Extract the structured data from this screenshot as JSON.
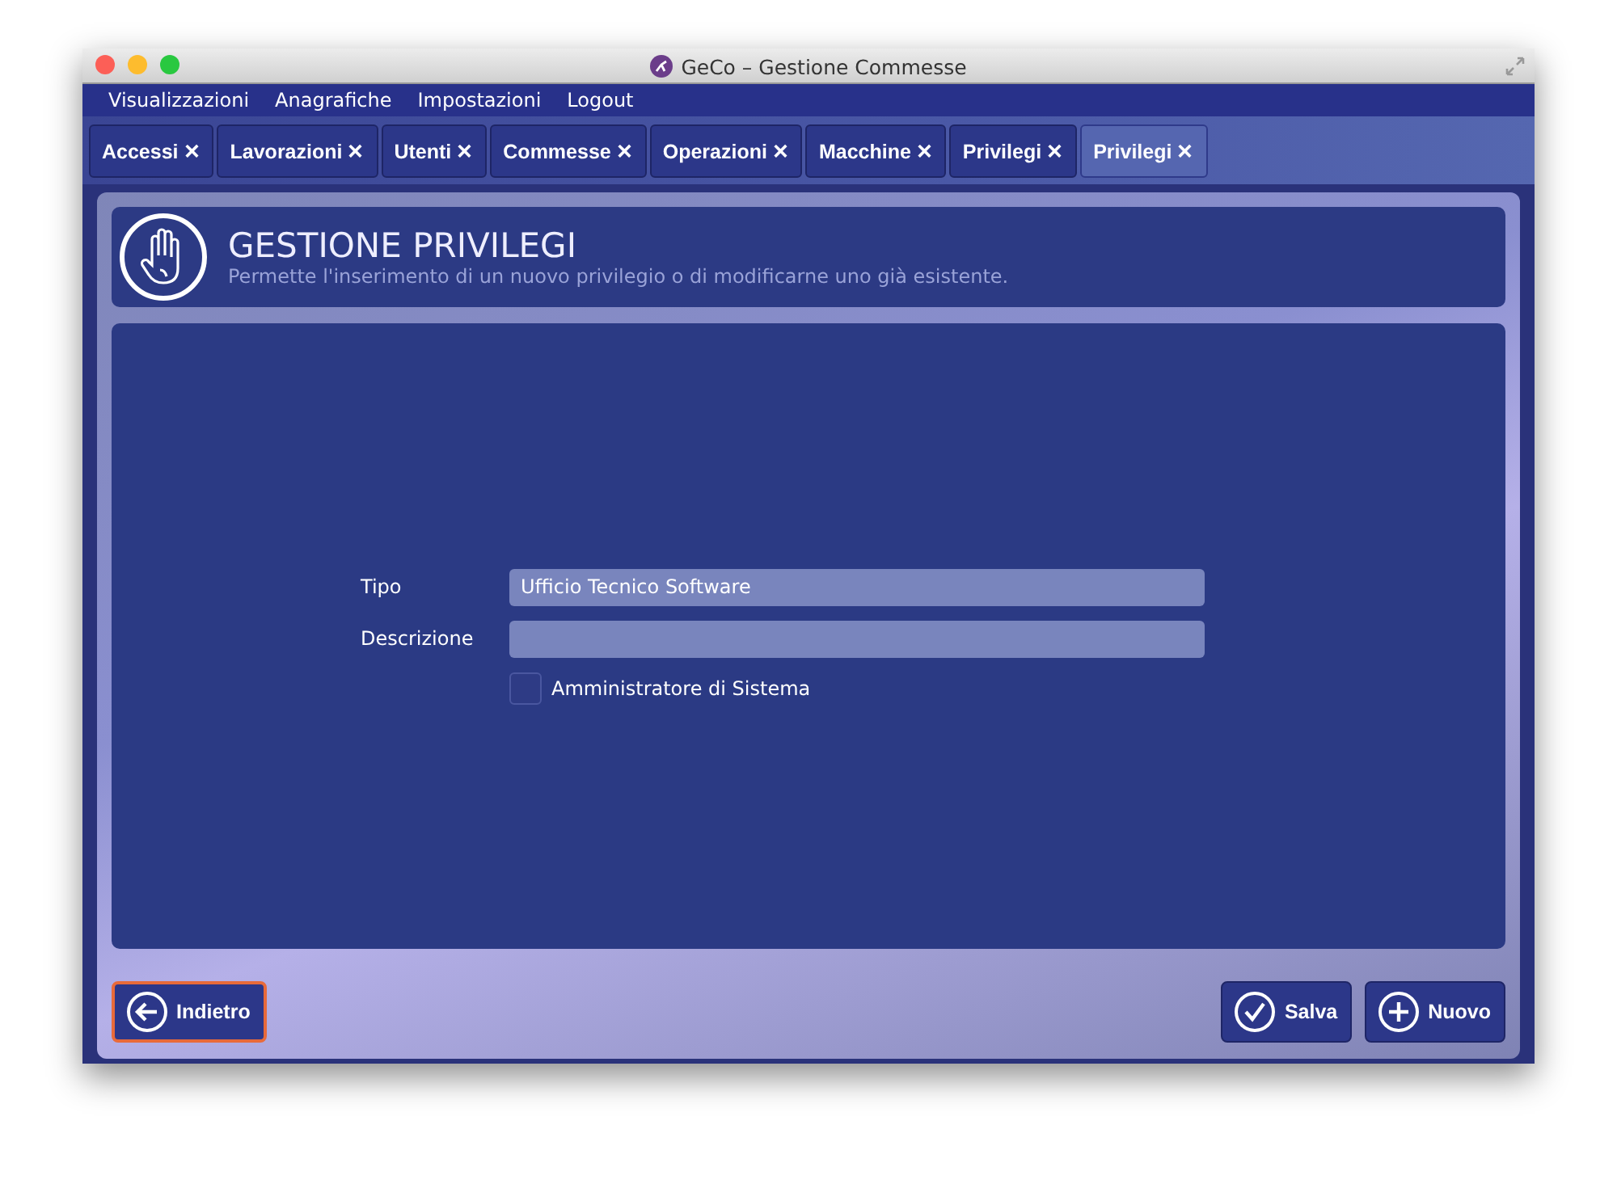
{
  "window": {
    "title": "GeCo – Gestione Commesse"
  },
  "menu": [
    "Visualizzazioni",
    "Anagrafiche",
    "Impostazioni",
    "Logout"
  ],
  "tabs": [
    {
      "label": "Accessi",
      "close": "✕",
      "selected": false
    },
    {
      "label": "Lavorazioni",
      "close": "✕",
      "selected": false
    },
    {
      "label": "Utenti",
      "close": "✕",
      "selected": false
    },
    {
      "label": "Commesse",
      "close": "✕",
      "selected": false
    },
    {
      "label": "Operazioni",
      "close": "✕",
      "selected": false
    },
    {
      "label": "Macchine",
      "close": "✕",
      "selected": false
    },
    {
      "label": "Privilegi",
      "close": "✕",
      "selected": false
    },
    {
      "label": "Privilegi",
      "close": "✕",
      "selected": true
    }
  ],
  "header": {
    "title": "GESTIONE PRIVILEGI",
    "subtitle": "Permette l'inserimento di un nuovo privilegio o di modificarne uno già esistente."
  },
  "form": {
    "fields": [
      {
        "label": "Tipo",
        "value": "Ufficio Tecnico Software"
      },
      {
        "label": "Descrizione"
      }
    ],
    "checkbox": {
      "label": "Amministratore di Sistema",
      "checked": false
    }
  },
  "buttons": [
    {
      "kind": "back",
      "label": "Indietro",
      "focused": true
    },
    {
      "kind": "save",
      "label": "Salva",
      "focused": false
    },
    {
      "kind": "new",
      "label": "Nuovo",
      "focused": false
    }
  ]
}
